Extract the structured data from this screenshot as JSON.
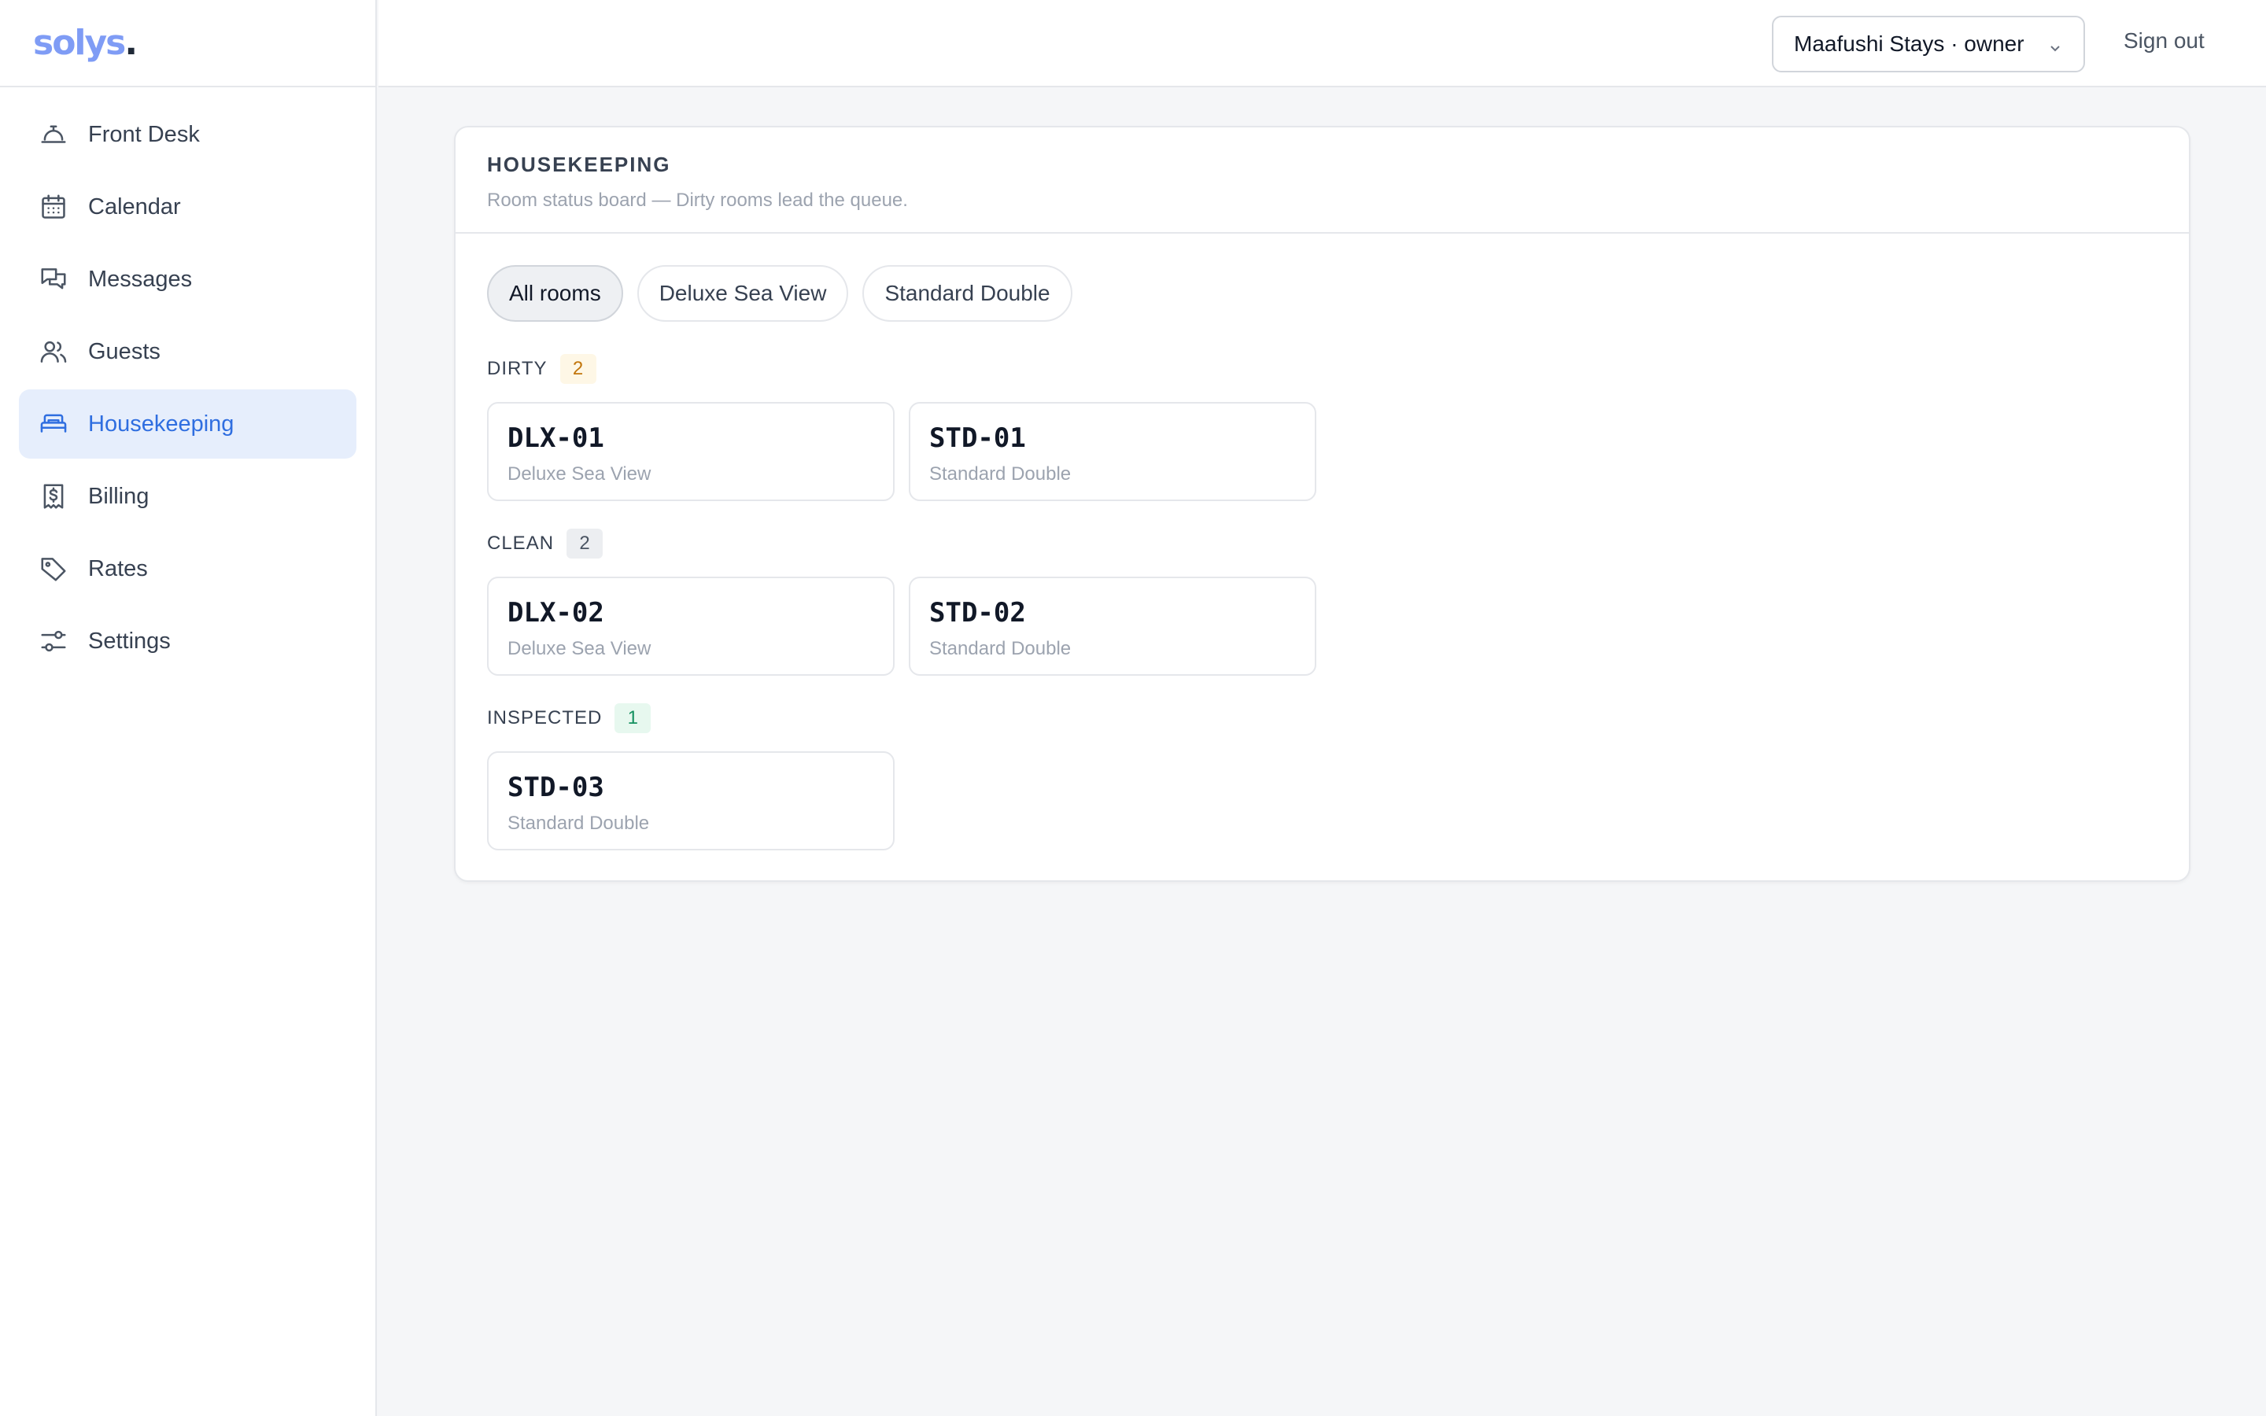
{
  "brand": {
    "name": "solys",
    "dot": "."
  },
  "sidebar": {
    "items": [
      {
        "label": "Front Desk",
        "icon": "concierge-bell-icon",
        "active": false
      },
      {
        "label": "Calendar",
        "icon": "calendar-icon",
        "active": false
      },
      {
        "label": "Messages",
        "icon": "chat-bubbles-icon",
        "active": false
      },
      {
        "label": "Guests",
        "icon": "users-icon",
        "active": false
      },
      {
        "label": "Housekeeping",
        "icon": "bed-icon",
        "active": true
      },
      {
        "label": "Billing",
        "icon": "receipt-dollar-icon",
        "active": false
      },
      {
        "label": "Rates",
        "icon": "tag-icon",
        "active": false
      },
      {
        "label": "Settings",
        "icon": "sliders-icon",
        "active": false
      }
    ]
  },
  "topbar": {
    "org_select": "Maafushi Stays · owner",
    "sign_out": "Sign out"
  },
  "card": {
    "title": "HOUSEKEEPING",
    "subtitle": "Room status board — Dirty rooms lead the queue."
  },
  "filters": [
    {
      "label": "All rooms",
      "active": true
    },
    {
      "label": "Deluxe Sea View",
      "active": false
    },
    {
      "label": "Standard Double",
      "active": false
    }
  ],
  "groups": {
    "dirty": {
      "label": "DIRTY",
      "count": "2",
      "rooms": [
        {
          "code": "DLX-01",
          "type": "Deluxe Sea View"
        },
        {
          "code": "STD-01",
          "type": "Standard Double"
        }
      ]
    },
    "clean": {
      "label": "CLEAN",
      "count": "2",
      "rooms": [
        {
          "code": "DLX-02",
          "type": "Deluxe Sea View"
        },
        {
          "code": "STD-02",
          "type": "Standard Double"
        }
      ]
    },
    "inspected": {
      "label": "INSPECTED",
      "count": "1",
      "rooms": [
        {
          "code": "STD-03",
          "type": "Standard Double"
        }
      ]
    }
  },
  "colors": {
    "accent": "#2f6ee0",
    "active_nav_bg": "#e6eefc",
    "brand": "#7f9cf5",
    "dirty_badge": "#c2760c",
    "inspected_badge": "#159160"
  }
}
